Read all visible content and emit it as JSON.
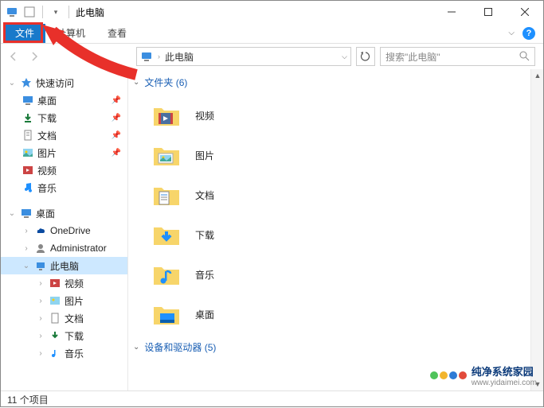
{
  "title": "此电脑",
  "ribbon": {
    "file": "文件",
    "computer": "计算机",
    "view": "查看"
  },
  "address": {
    "location": "此电脑"
  },
  "search": {
    "placeholder": "搜索\"此电脑\""
  },
  "sidebar": {
    "quick_access": "快速访问",
    "quick_items": [
      {
        "label": "桌面",
        "icon": "desktop"
      },
      {
        "label": "下载",
        "icon": "download"
      },
      {
        "label": "文档",
        "icon": "document"
      },
      {
        "label": "图片",
        "icon": "picture"
      },
      {
        "label": "视频",
        "icon": "video"
      },
      {
        "label": "音乐",
        "icon": "music"
      }
    ],
    "desktop": "桌面",
    "desktop_children": [
      {
        "label": "OneDrive",
        "icon": "onedrive"
      },
      {
        "label": "Administrator",
        "icon": "user"
      },
      {
        "label": "此电脑",
        "icon": "pc",
        "selected": true
      },
      {
        "label": "视频",
        "icon": "video"
      },
      {
        "label": "图片",
        "icon": "picture"
      },
      {
        "label": "文档",
        "icon": "document"
      },
      {
        "label": "下载",
        "icon": "download"
      },
      {
        "label": "音乐",
        "icon": "music"
      }
    ]
  },
  "content": {
    "folders_header": "文件夹 (6)",
    "folders": [
      {
        "label": "视频",
        "icon": "video"
      },
      {
        "label": "图片",
        "icon": "picture"
      },
      {
        "label": "文档",
        "icon": "document"
      },
      {
        "label": "下载",
        "icon": "download"
      },
      {
        "label": "音乐",
        "icon": "music"
      },
      {
        "label": "桌面",
        "icon": "desktop"
      }
    ],
    "devices_header": "设备和驱动器 (5)"
  },
  "status": {
    "text": "11 个项目"
  },
  "watermark": {
    "brand": "纯净系统家园",
    "url": "www.yidaimei.com"
  }
}
